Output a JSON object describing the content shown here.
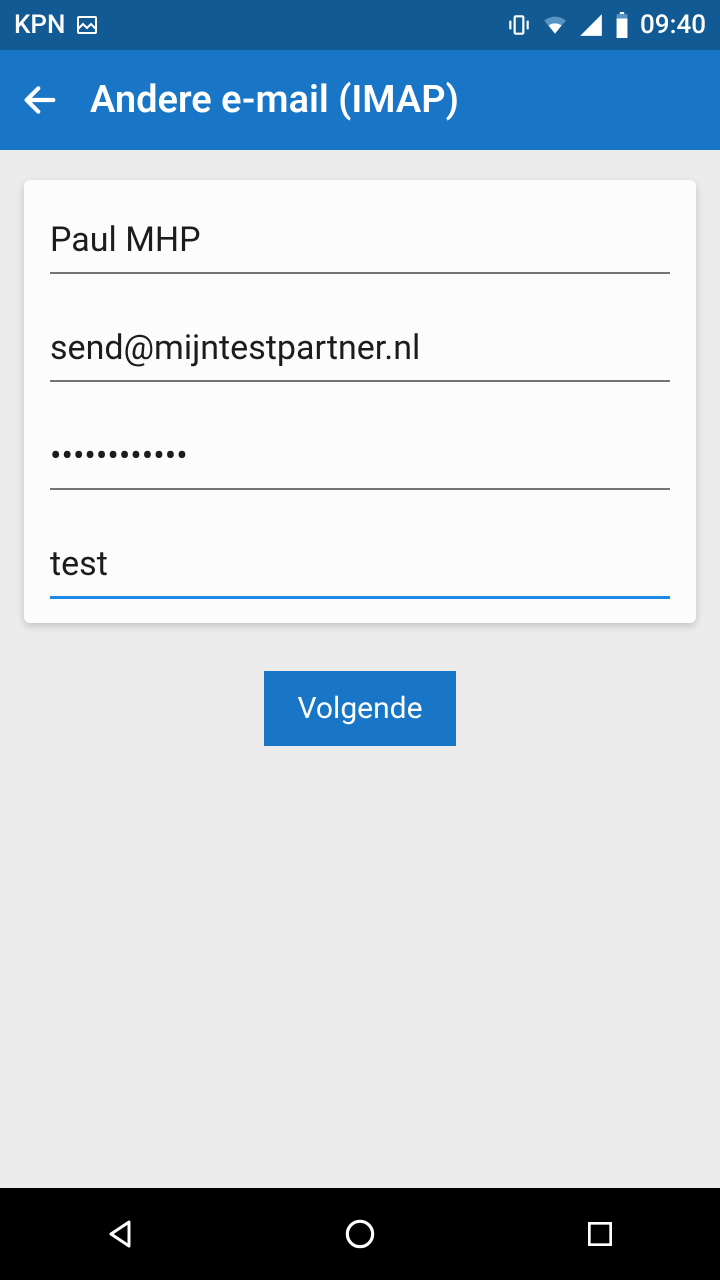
{
  "status": {
    "carrier": "KPN",
    "time": "09:40"
  },
  "appbar": {
    "title": "Andere e-mail (IMAP)"
  },
  "form": {
    "name": "Paul MHP",
    "email": "send@mijntestpartner.nl",
    "password": "••••••••••••",
    "description": "test"
  },
  "buttons": {
    "next": "Volgende"
  }
}
